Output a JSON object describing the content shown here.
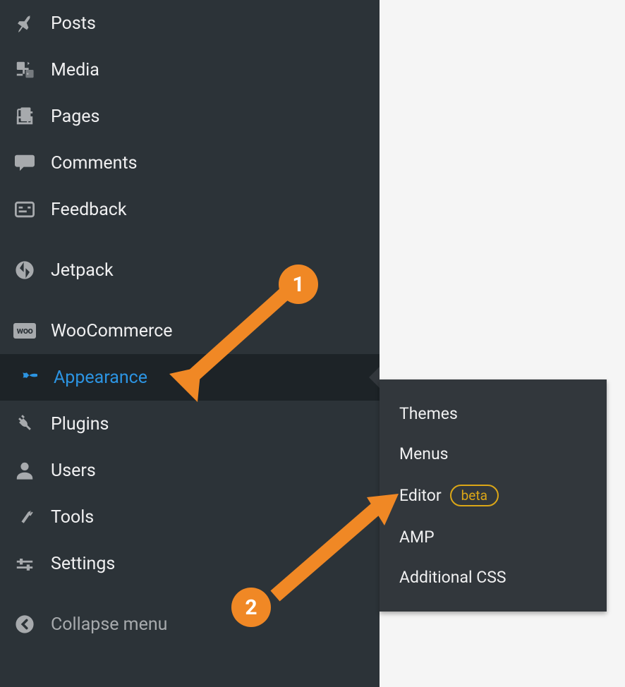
{
  "sidebar": {
    "items": [
      {
        "label": "Posts",
        "icon": "pin-icon"
      },
      {
        "label": "Media",
        "icon": "media-icon"
      },
      {
        "label": "Pages",
        "icon": "pages-icon"
      },
      {
        "label": "Comments",
        "icon": "comment-icon"
      },
      {
        "label": "Feedback",
        "icon": "feedback-icon"
      },
      {
        "label": "Jetpack",
        "icon": "jetpack-icon"
      },
      {
        "label": "WooCommerce",
        "icon": "woo-icon"
      },
      {
        "label": "Appearance",
        "icon": "brush-icon",
        "active": true
      },
      {
        "label": "Plugins",
        "icon": "plugin-icon"
      },
      {
        "label": "Users",
        "icon": "users-icon"
      },
      {
        "label": "Tools",
        "icon": "tools-icon"
      },
      {
        "label": "Settings",
        "icon": "settings-icon"
      }
    ],
    "collapse_label": "Collapse menu"
  },
  "submenu": {
    "items": [
      {
        "label": "Themes"
      },
      {
        "label": "Menus"
      },
      {
        "label": "Editor",
        "badge": "beta"
      },
      {
        "label": "AMP"
      },
      {
        "label": "Additional CSS"
      }
    ]
  },
  "annotations": {
    "num1": "1",
    "num2": "2"
  }
}
